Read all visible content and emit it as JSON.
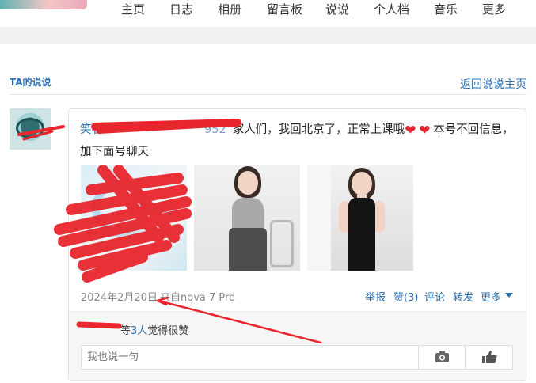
{
  "nav": {
    "items": [
      "主页",
      "日志",
      "相册",
      "留言板",
      "说说",
      "个人档",
      "音乐",
      "更多"
    ]
  },
  "section": {
    "title": "TA的说说",
    "back_link": "返回说说主页"
  },
  "post": {
    "author_visible": "笑看",
    "author_tail": "952",
    "text": "家人们，我回北京了，正常上课哦",
    "text_after": "本号不回信息，加下面号聊天",
    "hearts": "❤",
    "date": "2024年2月20日",
    "from": "来自nova 7 Pro",
    "actions": {
      "report": "举报",
      "like": "赞(3)",
      "comment": "评论",
      "forward": "转发",
      "more": "更多"
    },
    "likes_text_prefix": "等",
    "likes_count": "3人",
    "likes_text_suffix": "觉得很赞",
    "comment_placeholder": "我也说一句"
  },
  "colors": {
    "link": "#2b6fb0",
    "scribble": "#e8262d",
    "heart": "#e2262e"
  },
  "icons": {
    "camera": "camera-icon",
    "thumbs_up": "thumbs-up-icon",
    "caret": "caret-down-icon"
  }
}
